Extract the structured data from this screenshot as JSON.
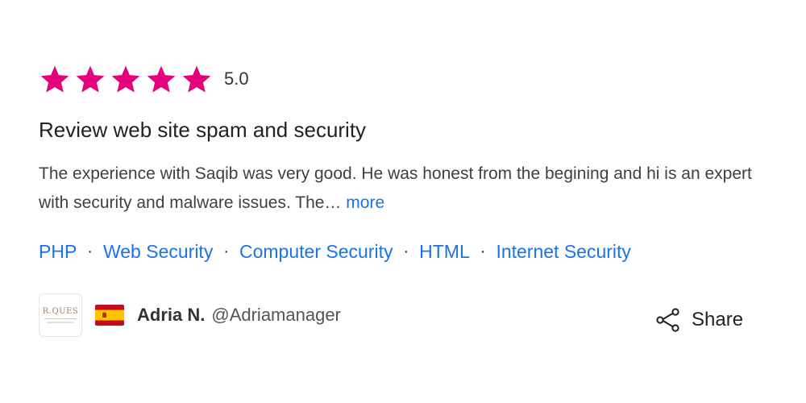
{
  "review": {
    "stars": 5,
    "star_color": "#e5007e",
    "rating_value": "5.0",
    "title": "Review web site spam and security",
    "body": "The experience with Saqib was very good. He was honest from the begining and hi is an expert with security and malware issues. The…",
    "more_label": "more"
  },
  "skills": [
    "PHP",
    "Web Security",
    "Computer Security",
    "HTML",
    "Internet Security"
  ],
  "skill_separator": "·",
  "link_color": "#1a73e8",
  "reviewer": {
    "logo_text": "R.QUES",
    "flag": "spain-flag-icon",
    "name": "Adria N.",
    "handle": "@Adriamanager"
  },
  "share": {
    "icon": "share-icon",
    "label": "Share"
  }
}
